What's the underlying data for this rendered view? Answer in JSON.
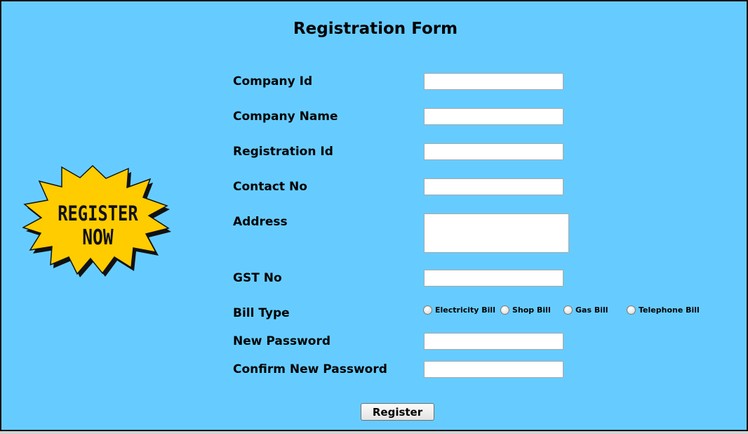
{
  "form": {
    "title": "Registration Form",
    "fields": {
      "company_id": {
        "label": "Company Id",
        "value": ""
      },
      "company_name": {
        "label": "Company Name",
        "value": ""
      },
      "registration_id": {
        "label": "Registration Id",
        "value": ""
      },
      "contact_no": {
        "label": "Contact No",
        "value": ""
      },
      "address": {
        "label": "Address",
        "value": ""
      },
      "gst_no": {
        "label": "GST No",
        "value": ""
      },
      "new_password": {
        "label": "New Password",
        "value": ""
      },
      "confirm_password": {
        "label": "Confirm New Password",
        "value": ""
      }
    },
    "bill_type": {
      "label": "Bill Type",
      "options": [
        "Electricity Bill",
        "Shop Bill",
        "Gas Bill",
        "Telephone Bill"
      ],
      "selected": null
    },
    "submit_label": "Register"
  },
  "badge": {
    "line1": "REGISTER",
    "line2": "NOW",
    "fill_color": "#ffcc00",
    "outline_color": "#111111"
  },
  "colors": {
    "background": "#66ccff",
    "border": "#111111"
  }
}
